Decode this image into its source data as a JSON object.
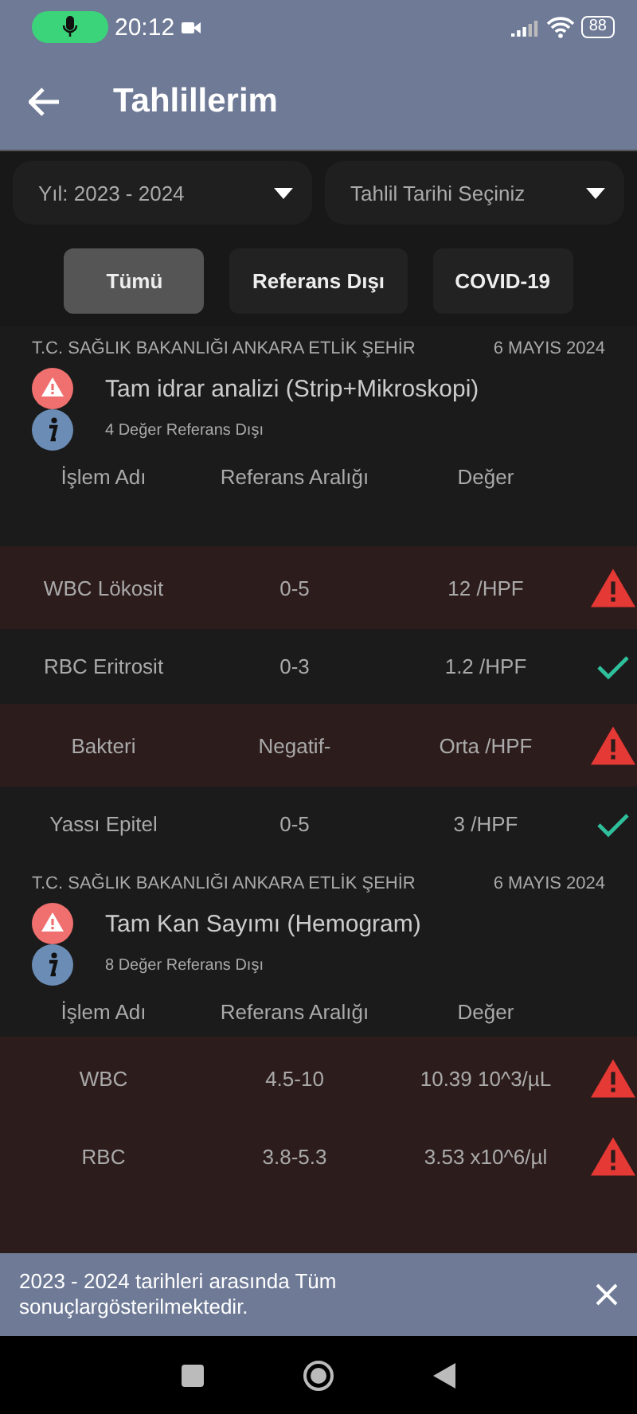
{
  "status_bar": {
    "time": "20:12",
    "battery": "88"
  },
  "header": {
    "title": "Tahlillerim"
  },
  "filters": [
    {
      "label": "Yıl: 2023 - 2024"
    },
    {
      "label": "Tahlil Tarihi Seçiniz"
    }
  ],
  "tabs": [
    {
      "label": "Tümü",
      "selected": true
    },
    {
      "label": "Referans Dışı",
      "selected": false
    },
    {
      "label": "COVID-19",
      "selected": false
    }
  ],
  "results": [
    {
      "hospital": "T.C. SAĞLIK BAKANLIĞI ANKARA ETLİK ŞEHİR",
      "date": "6 MAYIS 2024",
      "test": "Tam idrar analizi (Strip+Mikroskopi)",
      "summary": "4 Değer Referans Dışı",
      "columns": [
        "İşlem Adı",
        "Referans Aralığı",
        "Değer"
      ],
      "rows": [
        {
          "name": "WBC Lökosit",
          "range": "0-5",
          "value": "12 /HPF",
          "abnormal": true
        },
        {
          "name": "RBC Eritrosit",
          "range": "0-3",
          "value": "1.2 /HPF",
          "abnormal": false
        },
        {
          "name": "Bakteri",
          "range": "Negatif-",
          "value": "Orta /HPF",
          "abnormal": true
        },
        {
          "name": "Yassı Epitel",
          "range": "0-5",
          "value": "3 /HPF",
          "abnormal": false
        }
      ]
    },
    {
      "hospital": "T.C. SAĞLIK BAKANLIĞI ANKARA ETLİK ŞEHİR",
      "date": "6 MAYIS 2024",
      "test": "Tam Kan Sayımı (Hemogram)",
      "summary": "8 Değer Referans Dışı",
      "columns": [
        "İşlem Adı",
        "Referans Aralığı",
        "Değer"
      ],
      "partial_bottom_row": {
        "abnormal": true
      },
      "rows": [
        {
          "name": "WBC",
          "range": "4.5-10",
          "value": "10.39 10^3/µL",
          "abnormal": true
        },
        {
          "name": "RBC",
          "range": "3.8-5.3",
          "value": "3.53 x10^6/µl",
          "abnormal": true
        }
      ]
    }
  ],
  "snackbar": {
    "message": "2023 - 2024 tarihleri arasında Tüm sonuçlargösterilmektedir."
  }
}
